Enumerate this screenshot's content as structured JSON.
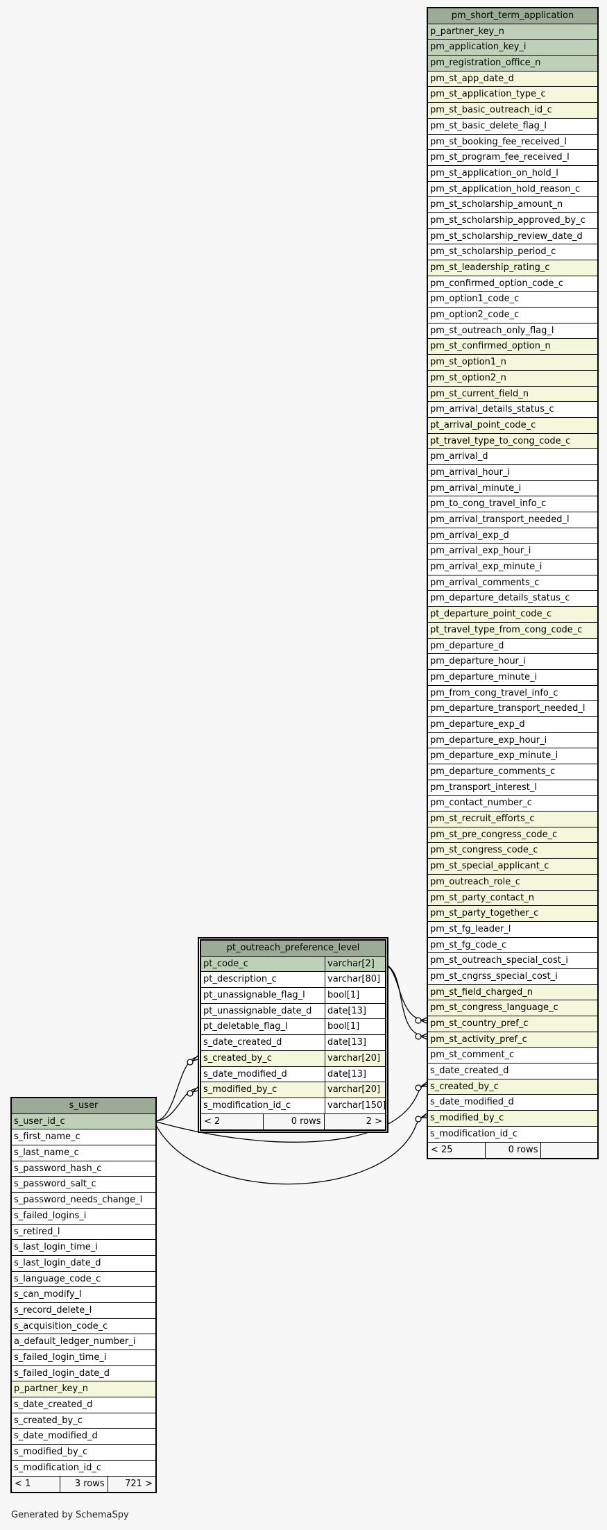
{
  "footer_text": "Generated by SchemaSpy",
  "tables": {
    "app": {
      "name": "pm_short_term_application",
      "footer": [
        "< 25",
        "0 rows",
        ""
      ],
      "columns": [
        {
          "n": "p_partner_key_n",
          "k": "pk"
        },
        {
          "n": "pm_application_key_i",
          "k": "pk"
        },
        {
          "n": "pm_registration_office_n",
          "k": "pk"
        },
        {
          "n": "pm_st_app_date_d",
          "k": "fk"
        },
        {
          "n": "pm_st_application_type_c",
          "k": "fk"
        },
        {
          "n": "pm_st_basic_outreach_id_c",
          "k": "fk"
        },
        {
          "n": "pm_st_basic_delete_flag_l",
          "k": ""
        },
        {
          "n": "pm_st_booking_fee_received_l",
          "k": ""
        },
        {
          "n": "pm_st_program_fee_received_l",
          "k": ""
        },
        {
          "n": "pm_st_application_on_hold_l",
          "k": ""
        },
        {
          "n": "pm_st_application_hold_reason_c",
          "k": ""
        },
        {
          "n": "pm_st_scholarship_amount_n",
          "k": ""
        },
        {
          "n": "pm_st_scholarship_approved_by_c",
          "k": ""
        },
        {
          "n": "pm_st_scholarship_review_date_d",
          "k": ""
        },
        {
          "n": "pm_st_scholarship_period_c",
          "k": ""
        },
        {
          "n": "pm_st_leadership_rating_c",
          "k": "fk"
        },
        {
          "n": "pm_confirmed_option_code_c",
          "k": ""
        },
        {
          "n": "pm_option1_code_c",
          "k": ""
        },
        {
          "n": "pm_option2_code_c",
          "k": ""
        },
        {
          "n": "pm_st_outreach_only_flag_l",
          "k": ""
        },
        {
          "n": "pm_st_confirmed_option_n",
          "k": "fk"
        },
        {
          "n": "pm_st_option1_n",
          "k": "fk"
        },
        {
          "n": "pm_st_option2_n",
          "k": "fk"
        },
        {
          "n": "pm_st_current_field_n",
          "k": "fk"
        },
        {
          "n": "pm_arrival_details_status_c",
          "k": ""
        },
        {
          "n": "pt_arrival_point_code_c",
          "k": "fk"
        },
        {
          "n": "pt_travel_type_to_cong_code_c",
          "k": "fk"
        },
        {
          "n": "pm_arrival_d",
          "k": ""
        },
        {
          "n": "pm_arrival_hour_i",
          "k": ""
        },
        {
          "n": "pm_arrival_minute_i",
          "k": ""
        },
        {
          "n": "pm_to_cong_travel_info_c",
          "k": ""
        },
        {
          "n": "pm_arrival_transport_needed_l",
          "k": ""
        },
        {
          "n": "pm_arrival_exp_d",
          "k": ""
        },
        {
          "n": "pm_arrival_exp_hour_i",
          "k": ""
        },
        {
          "n": "pm_arrival_exp_minute_i",
          "k": ""
        },
        {
          "n": "pm_arrival_comments_c",
          "k": ""
        },
        {
          "n": "pm_departure_details_status_c",
          "k": ""
        },
        {
          "n": "pt_departure_point_code_c",
          "k": "fk"
        },
        {
          "n": "pt_travel_type_from_cong_code_c",
          "k": "fk"
        },
        {
          "n": "pm_departure_d",
          "k": ""
        },
        {
          "n": "pm_departure_hour_i",
          "k": ""
        },
        {
          "n": "pm_departure_minute_i",
          "k": ""
        },
        {
          "n": "pm_from_cong_travel_info_c",
          "k": ""
        },
        {
          "n": "pm_departure_transport_needed_l",
          "k": ""
        },
        {
          "n": "pm_departure_exp_d",
          "k": ""
        },
        {
          "n": "pm_departure_exp_hour_i",
          "k": ""
        },
        {
          "n": "pm_departure_exp_minute_i",
          "k": ""
        },
        {
          "n": "pm_departure_comments_c",
          "k": ""
        },
        {
          "n": "pm_transport_interest_l",
          "k": ""
        },
        {
          "n": "pm_contact_number_c",
          "k": ""
        },
        {
          "n": "pm_st_recruit_efforts_c",
          "k": "fk"
        },
        {
          "n": "pm_st_pre_congress_code_c",
          "k": "fk"
        },
        {
          "n": "pm_st_congress_code_c",
          "k": "fk"
        },
        {
          "n": "pm_st_special_applicant_c",
          "k": "fk"
        },
        {
          "n": "pm_outreach_role_c",
          "k": "fk"
        },
        {
          "n": "pm_st_party_contact_n",
          "k": "fk"
        },
        {
          "n": "pm_st_party_together_c",
          "k": "fk"
        },
        {
          "n": "pm_st_fg_leader_l",
          "k": ""
        },
        {
          "n": "pm_st_fg_code_c",
          "k": ""
        },
        {
          "n": "pm_st_outreach_special_cost_i",
          "k": ""
        },
        {
          "n": "pm_st_cngrss_special_cost_i",
          "k": ""
        },
        {
          "n": "pm_st_field_charged_n",
          "k": "fk"
        },
        {
          "n": "pm_st_congress_language_c",
          "k": "fk"
        },
        {
          "n": "pm_st_country_pref_c",
          "k": "fk"
        },
        {
          "n": "pm_st_activity_pref_c",
          "k": "fk"
        },
        {
          "n": "pm_st_comment_c",
          "k": ""
        },
        {
          "n": "s_date_created_d",
          "k": ""
        },
        {
          "n": "s_created_by_c",
          "k": "fk"
        },
        {
          "n": "s_date_modified_d",
          "k": ""
        },
        {
          "n": "s_modified_by_c",
          "k": "fk"
        },
        {
          "n": "s_modification_id_c",
          "k": ""
        }
      ]
    },
    "pref": {
      "name": "pt_outreach_preference_level",
      "footer": [
        "< 2",
        "0 rows",
        "2 >"
      ],
      "columns": [
        {
          "n": "pt_code_c",
          "t": "varchar[2]",
          "k": "pk"
        },
        {
          "n": "pt_description_c",
          "t": "varchar[80]",
          "k": ""
        },
        {
          "n": "pt_unassignable_flag_l",
          "t": "bool[1]",
          "k": ""
        },
        {
          "n": "pt_unassignable_date_d",
          "t": "date[13]",
          "k": ""
        },
        {
          "n": "pt_deletable_flag_l",
          "t": "bool[1]",
          "k": ""
        },
        {
          "n": "s_date_created_d",
          "t": "date[13]",
          "k": ""
        },
        {
          "n": "s_created_by_c",
          "t": "varchar[20]",
          "k": "fk"
        },
        {
          "n": "s_date_modified_d",
          "t": "date[13]",
          "k": ""
        },
        {
          "n": "s_modified_by_c",
          "t": "varchar[20]",
          "k": "fk"
        },
        {
          "n": "s_modification_id_c",
          "t": "varchar[150]",
          "k": ""
        }
      ]
    },
    "user": {
      "name": "s_user",
      "footer": [
        "< 1",
        "3 rows",
        "721 >"
      ],
      "columns": [
        {
          "n": "s_user_id_c",
          "k": "pk"
        },
        {
          "n": "s_first_name_c",
          "k": ""
        },
        {
          "n": "s_last_name_c",
          "k": ""
        },
        {
          "n": "s_password_hash_c",
          "k": ""
        },
        {
          "n": "s_password_salt_c",
          "k": ""
        },
        {
          "n": "s_password_needs_change_l",
          "k": ""
        },
        {
          "n": "s_failed_logins_i",
          "k": ""
        },
        {
          "n": "s_retired_l",
          "k": ""
        },
        {
          "n": "s_last_login_time_i",
          "k": ""
        },
        {
          "n": "s_last_login_date_d",
          "k": ""
        },
        {
          "n": "s_language_code_c",
          "k": ""
        },
        {
          "n": "s_can_modify_l",
          "k": ""
        },
        {
          "n": "s_record_delete_l",
          "k": ""
        },
        {
          "n": "s_acquisition_code_c",
          "k": ""
        },
        {
          "n": "a_default_ledger_number_i",
          "k": ""
        },
        {
          "n": "s_failed_login_time_i",
          "k": ""
        },
        {
          "n": "s_failed_login_date_d",
          "k": ""
        },
        {
          "n": "p_partner_key_n",
          "k": "fk"
        },
        {
          "n": "s_date_created_d",
          "k": ""
        },
        {
          "n": "s_created_by_c",
          "k": ""
        },
        {
          "n": "s_date_modified_d",
          "k": ""
        },
        {
          "n": "s_modified_by_c",
          "k": ""
        },
        {
          "n": "s_modification_id_c",
          "k": ""
        }
      ]
    }
  }
}
